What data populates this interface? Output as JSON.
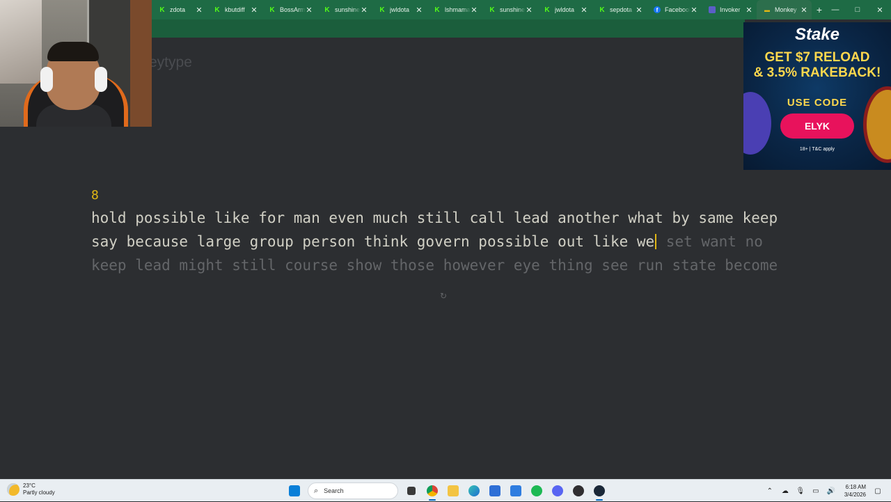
{
  "browser": {
    "tabs": [
      {
        "label": "zdota",
        "icon": "kick-icon",
        "partial": true
      },
      {
        "label": "kbutdiff",
        "icon": "kick-icon"
      },
      {
        "label": "BossArm",
        "icon": "kick-icon"
      },
      {
        "label": "sunshine",
        "icon": "kick-icon"
      },
      {
        "label": "jwldota",
        "icon": "kick-icon"
      },
      {
        "label": "lshmama",
        "icon": "kick-icon"
      },
      {
        "label": "sunshine",
        "icon": "kick-icon"
      },
      {
        "label": "jwldota",
        "icon": "kick-icon"
      },
      {
        "label": "sepdota",
        "icon": "kick-icon"
      },
      {
        "label": "Facebook",
        "icon": "facebook-icon"
      },
      {
        "label": "Invoker",
        "icon": "invoker-icon"
      },
      {
        "label": "Monkey",
        "icon": "monkeytype-icon",
        "active": true
      }
    ],
    "new_tab": "+",
    "window_controls": {
      "minimize": "—",
      "maximize": "□",
      "close": "✕"
    },
    "tab_close": "✕"
  },
  "page": {
    "logo_text": "eytype",
    "word_count": "8",
    "lines": [
      {
        "typed": "hold possible like for man even much still call lead another what by same keep",
        "untyped": ""
      },
      {
        "typed": "say because large group person think govern possible out like we",
        "untyped": " set want no"
      },
      {
        "typed": "",
        "untyped": "keep lead might still course show those however eye thing see run state become"
      }
    ],
    "restart_icon": "↻"
  },
  "ad": {
    "brand": "Stake",
    "headline_1": "GET $7 RELOAD",
    "headline_2": "& 3.5% RAKEBACK!",
    "use_code": "USE CODE",
    "code": "ELYK",
    "terms": "18+ | T&C apply"
  },
  "taskbar": {
    "weather_temp": "23°C",
    "weather_desc": "Partly cloudy",
    "search_label": "Search",
    "time": "6:18 AM",
    "date": "3/4/2026"
  },
  "colors": {
    "bg": "#2c2e31",
    "main": "#e2b714",
    "text": "#d1d0c5",
    "sub": "#646669",
    "tab_strip": "#1e6b45"
  }
}
